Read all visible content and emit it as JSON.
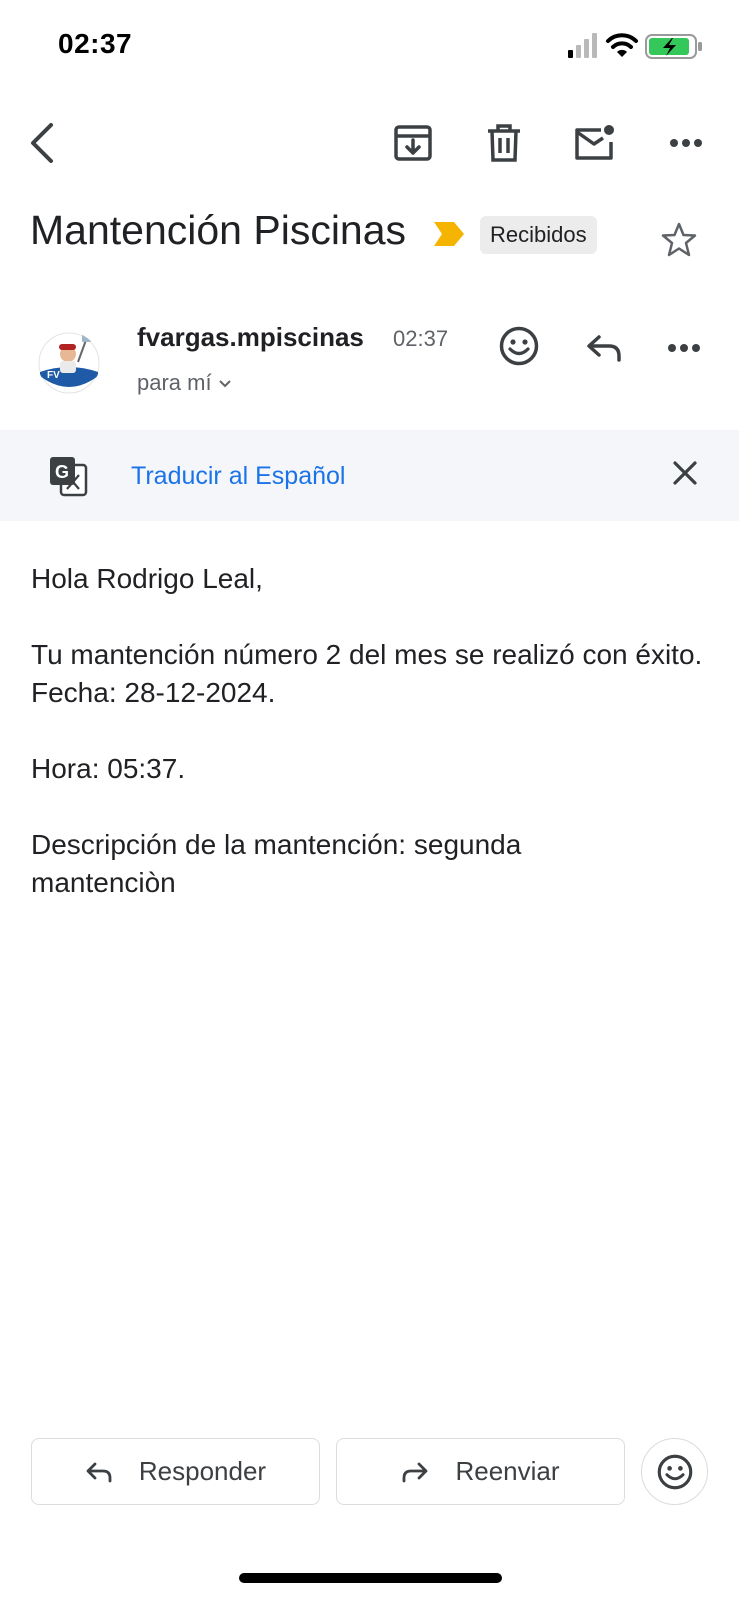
{
  "status_bar": {
    "time": "02:37"
  },
  "toolbar": {
    "back": "back-icon",
    "archive": "archive-icon",
    "delete": "trash-icon",
    "mark_unread": "mark-unread-icon",
    "more": "more-icon"
  },
  "email": {
    "subject": "Mantención Piscinas",
    "label": "Recibidos",
    "sender_name": "fvargas.mpiscinas",
    "time": "02:37",
    "recipient": "para mí",
    "body": {
      "greeting": "Hola Rodrigo Leal,",
      "line1": "Tu mantención número 2 del mes se realizó con éxito.",
      "line2": "Fecha: 28-12-2024.",
      "line3": "Hora: 05:37.",
      "line4": "Descripción de la mantención: segunda mantenciòn"
    }
  },
  "translate": {
    "link_text": "Traducir al Español"
  },
  "actions": {
    "reply": "Responder",
    "forward": "Reenviar"
  },
  "colors": {
    "accent_blue": "#1a73e8",
    "importance": "#f4b400",
    "translate_bg": "#f4f6f9"
  }
}
